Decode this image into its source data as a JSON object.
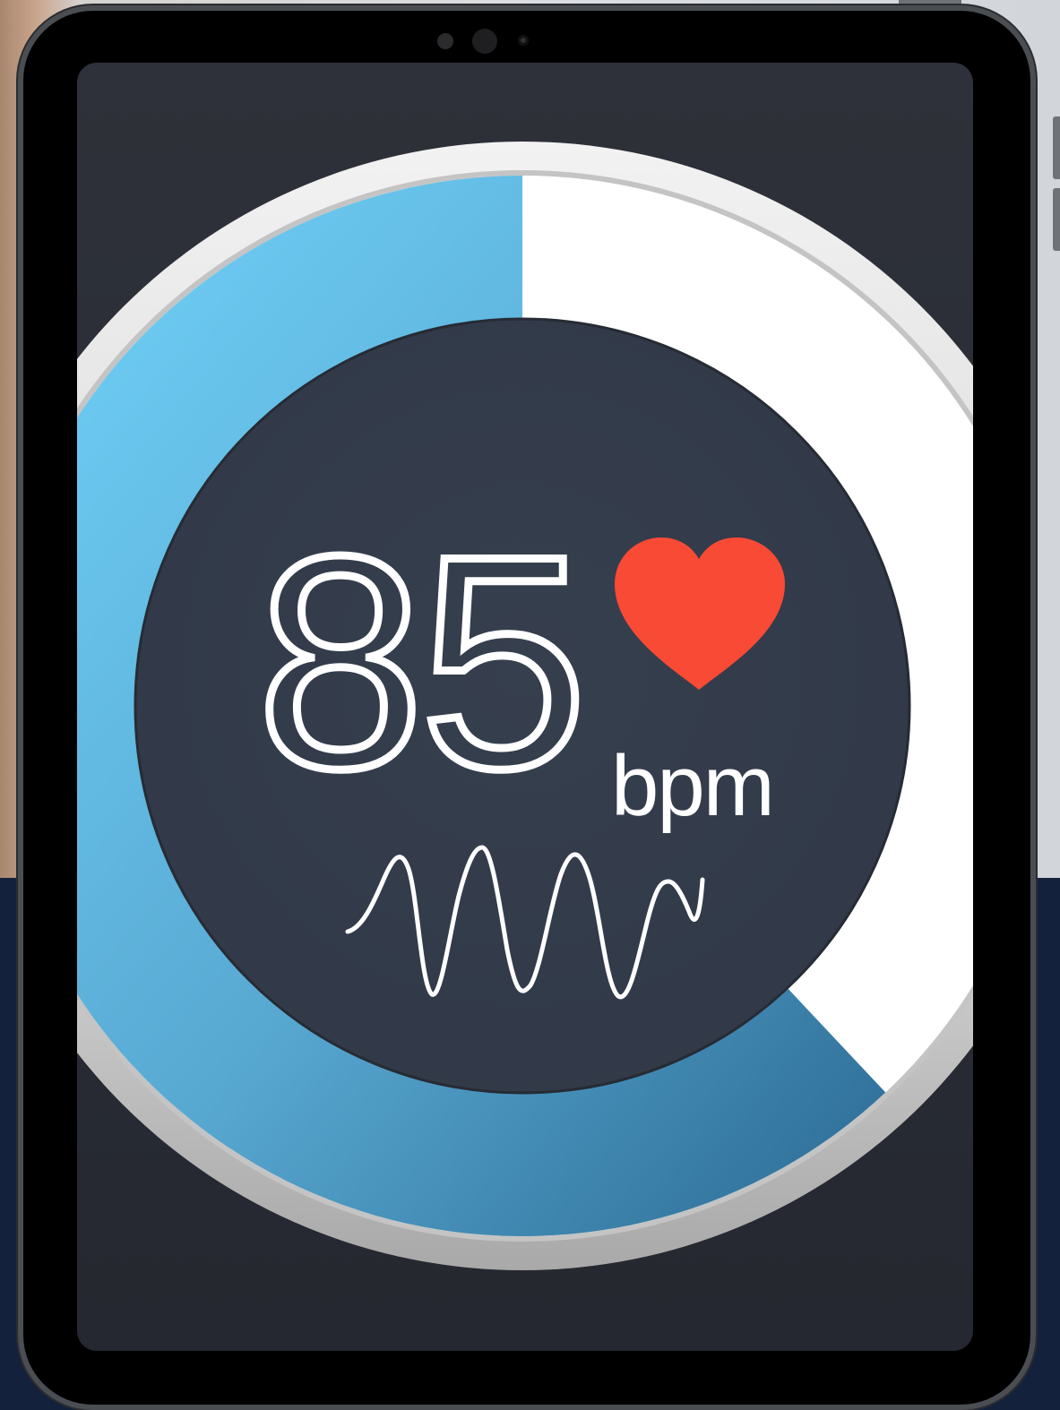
{
  "heart_rate": {
    "value": "85",
    "unit": "bpm",
    "progress_fraction": 0.62
  },
  "colors": {
    "progress_light": "#72d4fb",
    "progress_dark": "#2b6a93",
    "track": "#ffffff",
    "dial_center": "#343d4c",
    "heart": "#f84a35",
    "screen_bg": "#2b2e36",
    "page_bg_bottom": "#14213d"
  },
  "icons": {
    "heart": "heart-icon",
    "waveform": "pulse-wave-icon"
  }
}
